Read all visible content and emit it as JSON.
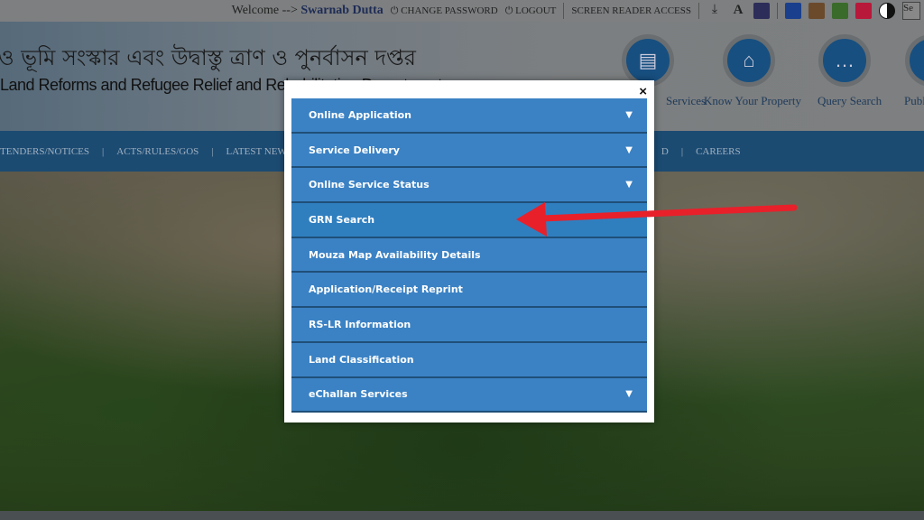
{
  "topbar": {
    "welcome": "Welcome -->",
    "user": "Swarnab Dutta",
    "change_password": "CHANGE PASSWORD",
    "logout": "LOGOUT",
    "screen_reader": "SCREEN READER ACCESS",
    "search_placeholder": "Se",
    "theme_colors": [
      "#1a3f8c",
      "#6b4a2c",
      "#3a6b2a",
      "#b8183a"
    ]
  },
  "header": {
    "title_bn": "ও ভূমি সংস্কার এবং উদ্বাস্তু ত্রাণ ও পুনর্বাসন দপ্তর",
    "title_en": "Land Reforms and Refugee Relief and Rehabilitation Department",
    "quick_links": [
      {
        "label": "Services",
        "icon": "id-card-icon"
      },
      {
        "label": "Know Your Property",
        "icon": "home-icon"
      },
      {
        "label": "Query Search",
        "icon": "chat-icon"
      },
      {
        "label": "Publi",
        "icon": "person-icon"
      }
    ]
  },
  "nav": {
    "items": [
      "TENDERS/NOTICES",
      "ACTS/RULES/GOS",
      "LATEST NEWS",
      "D",
      "CAREERS"
    ]
  },
  "modal": {
    "close": "×",
    "items": [
      {
        "label": "Online Application",
        "expandable": true
      },
      {
        "label": "Service Delivery",
        "expandable": true
      },
      {
        "label": "Online Service Status",
        "expandable": true
      },
      {
        "label": "GRN Search",
        "expandable": false
      },
      {
        "label": "Mouza Map Availability Details",
        "expandable": false
      },
      {
        "label": "Application/Receipt Reprint",
        "expandable": false
      },
      {
        "label": "RS-LR Information",
        "expandable": false
      },
      {
        "label": "Land Classification",
        "expandable": false
      },
      {
        "label": "eChallan Services",
        "expandable": true
      }
    ]
  },
  "annotation": {
    "arrow_color": "#e8202a",
    "points_to": "GRN Search"
  }
}
